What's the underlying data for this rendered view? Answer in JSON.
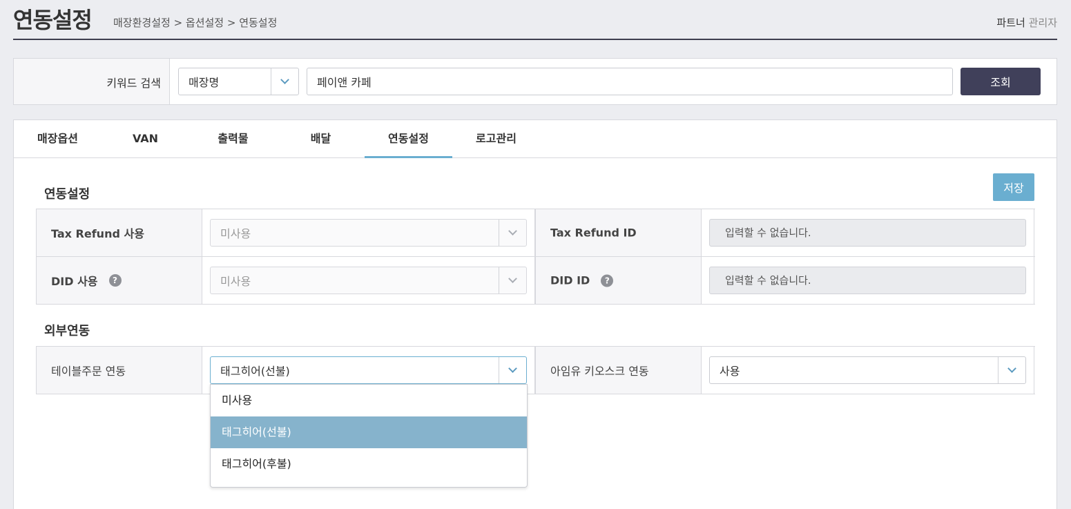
{
  "header": {
    "title": "연동설정",
    "breadcrumb": "매장환경설정 > 옵션설정 > 연동설정",
    "partner": "파트너",
    "admin": "관리자"
  },
  "search": {
    "label": "키워드 검색",
    "type_value": "매장명",
    "keyword_value": "페이앤 카페",
    "button_label": "조회"
  },
  "tabs": [
    {
      "label": "매장옵션",
      "active": false
    },
    {
      "label": "VAN",
      "active": false
    },
    {
      "label": "출력물",
      "active": false
    },
    {
      "label": "배달",
      "active": false
    },
    {
      "label": "연동설정",
      "active": true
    },
    {
      "label": "로고관리",
      "active": false
    }
  ],
  "integration": {
    "section_title": "연동설정",
    "save_label": "저장",
    "tax_refund_label": "Tax Refund 사용",
    "tax_refund_value": "미사용",
    "tax_refund_id_label": "Tax Refund ID",
    "tax_refund_id_placeholder": "입력할 수 없습니다.",
    "did_label": "DID 사용",
    "did_value": "미사용",
    "did_id_label": "DID ID",
    "did_id_placeholder": "입력할 수 없습니다.",
    "help_glyph": "?"
  },
  "external": {
    "section_title": "외부연동",
    "table_order_label": "테이블주문 연동",
    "table_order_value": "태그히어(선불)",
    "kiosk_label": "아임유 키오스크 연동",
    "kiosk_value": "사용"
  },
  "dropdown": {
    "options": [
      "미사용",
      "태그히어(선불)",
      "태그히어(후불)"
    ],
    "selected_index": 1
  },
  "colors": {
    "accent": "#6aaed0",
    "dark_button": "#40405a",
    "selected_option": "#86b3cc"
  }
}
